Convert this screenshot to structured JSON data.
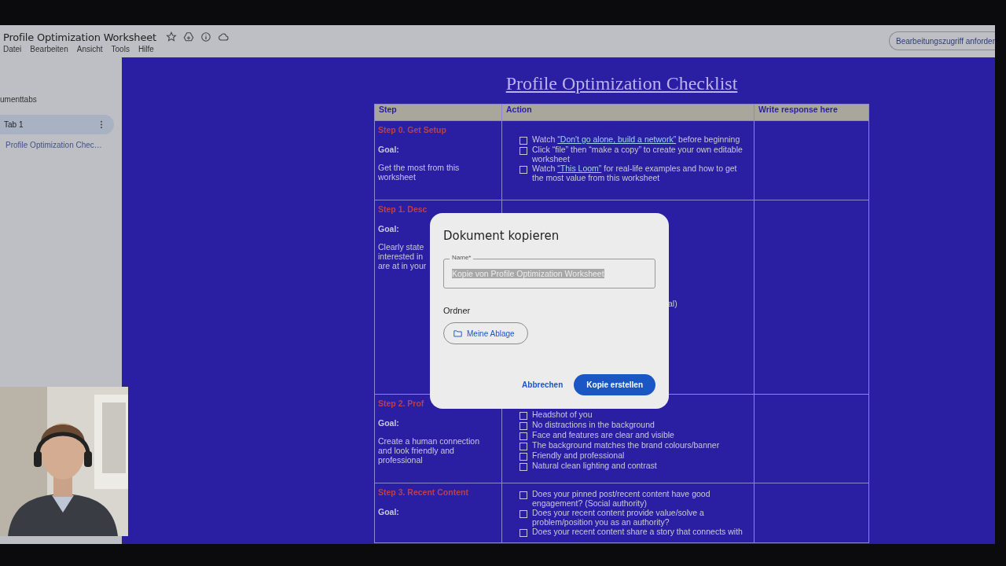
{
  "header": {
    "title": "Profile Optimization Worksheet",
    "menu": [
      "Datei",
      "Bearbeiten",
      "Ansicht",
      "Tools",
      "Hilfe"
    ],
    "access_button": "Bearbeitungszugriff anforder"
  },
  "sidebar": {
    "heading": "umenttabs",
    "tabs": [
      {
        "label": "Tab 1",
        "selected": true
      }
    ],
    "outline": [
      "Profile Optimization Chec…"
    ]
  },
  "page": {
    "heading": "Profile Optimization Checklist",
    "table": {
      "columns": [
        "Step",
        "Action",
        "Write response here"
      ],
      "rows": [
        {
          "step": "Step 0. Get Setup",
          "goal_label": "Goal:",
          "goal": "Get the most from this\nworksheet",
          "actions": [
            {
              "kind": "checkbox",
              "checked": false,
              "before": "Watch ",
              "link": "“Don't go alone, build a network”",
              "after": " before beginning"
            },
            {
              "kind": "checkbox",
              "checked": false,
              "before": "Click “file” then “make a copy” to create your own editable worksheet"
            },
            {
              "kind": "checkbox",
              "checked": false,
              "before": "Watch ",
              "link": "“This Loom”",
              "after": " for real-life examples and how to get the most value from this worksheet"
            }
          ]
        },
        {
          "step": "Step 1. Desc",
          "goal_label": "Goal:",
          "goal": "Clearly state\ninterested in\nare at in your",
          "actions": [
            {
              "kind": "fragment",
              "before": "al)"
            }
          ]
        },
        {
          "step": "Step 2. Prof",
          "goal_label": "Goal:",
          "goal": "Create a human connection\nand look friendly and\nprofessional",
          "actions": [
            {
              "kind": "checkbox",
              "checked": false,
              "before": "Headshot of you"
            },
            {
              "kind": "checkbox",
              "checked": false,
              "before": "No distractions in the background"
            },
            {
              "kind": "checkbox",
              "checked": false,
              "before": "Face and features are clear and visible"
            },
            {
              "kind": "checkbox",
              "checked": false,
              "before": "The background matches the brand colours/banner"
            },
            {
              "kind": "checkbox",
              "checked": false,
              "before": "Friendly and professional"
            },
            {
              "kind": "checkbox",
              "checked": false,
              "before": "Natural clean lighting and contrast"
            }
          ]
        },
        {
          "step": "Step 3. Recent Content",
          "goal_label": "Goal:",
          "actions": [
            {
              "kind": "checkbox",
              "checked": false,
              "before": "Does your pinned post/recent content have good engagement? (Social authority)"
            },
            {
              "kind": "checkbox",
              "checked": false,
              "before": "Does your recent content provide value/solve a problem/position you as an authority?"
            },
            {
              "kind": "checkbox",
              "checked": false,
              "before": "Does your recent content share a story that connects with"
            }
          ]
        }
      ]
    }
  },
  "dialog": {
    "title": "Dokument kopieren",
    "name_label": "Name*",
    "name_value": "Kopie von Profile Optimization Worksheet",
    "folder_label": "Ordner",
    "folder_button": "Meine Ablage",
    "cancel": "Abbrechen",
    "confirm": "Kopie erstellen"
  }
}
